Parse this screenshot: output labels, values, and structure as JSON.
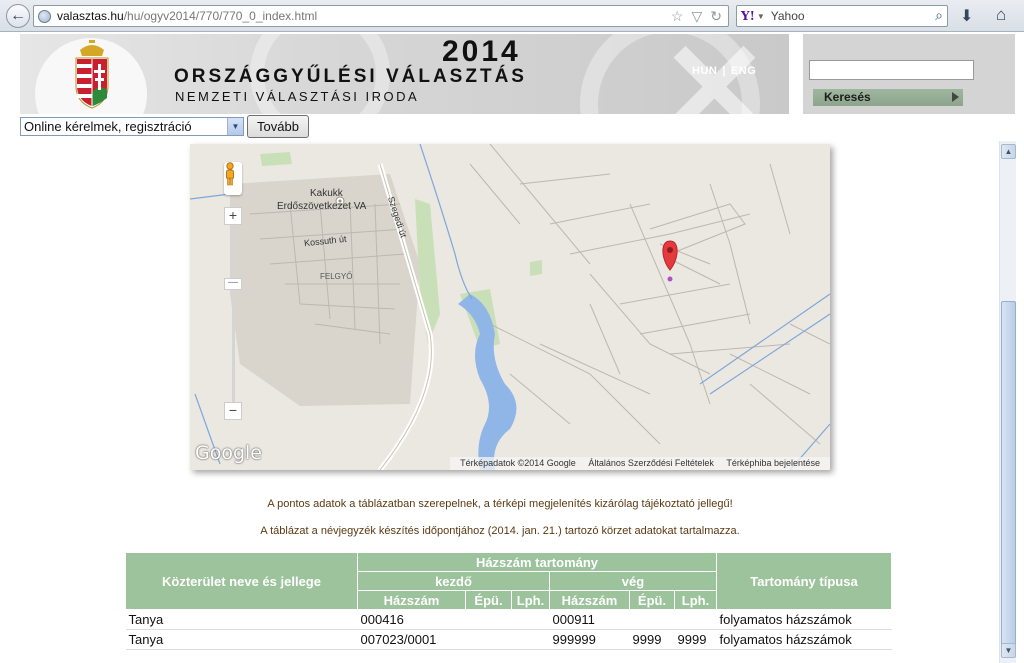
{
  "browser": {
    "url_host": "valasztas.hu",
    "url_path": "/hu/ogyv2014/770/770_0_index.html",
    "search_placeholder": "Yahoo"
  },
  "header": {
    "year": "2014",
    "title": "ORSZÁGGYŰLÉSI VÁLASZTÁS",
    "subtitle": "NEMZETI VÁLASZTÁSI IRODA",
    "lang_hu": "HUN",
    "lang_sep": "|",
    "lang_en": "ENG",
    "search_button": "Keresés"
  },
  "nav": {
    "select_value": "Online kérelmek, regisztráció",
    "go_button": "Tovább"
  },
  "map": {
    "labels": {
      "kakukk": "Kakukk",
      "erdo": "Erdőszövetkezet VA",
      "kossuth": "Kossuth út",
      "szegedi": "Szegedi út",
      "felgyo": "FELGYŐ"
    },
    "logo": "Google",
    "attribution": [
      "Térképadatok ©2014 Google",
      "Általános Szerződési Feltételek",
      "Térképhiba bejelentése"
    ],
    "zoom_in": "+",
    "zoom_out": "−"
  },
  "notes": {
    "line1": "A pontos adatok a táblázatban szerepelnek, a térképi megjelenítés kizárólag tájékoztató jellegű!",
    "line2": "A táblázat a névjegyzék készítés időpontjához (2014. jan. 21.) tartozó körzet adatokat tartalmazza."
  },
  "table": {
    "h_street": "Közterület neve és jellege",
    "h_range": "Házszám tartomány",
    "h_start": "kezdő",
    "h_end": "vég",
    "h_type": "Tartomány típusa",
    "h_hazszam": "Házszám",
    "h_epu": "Épü.",
    "h_lph": "Lph.",
    "rows": [
      [
        "Tanya",
        "000416",
        "",
        "",
        "000911",
        "",
        "",
        "folyamatos házszámok"
      ],
      [
        "Tanya",
        "007023/0001",
        "",
        "",
        "999999",
        "9999",
        "9999",
        "folyamatos házszámok"
      ]
    ]
  },
  "colors": {
    "table_header": "#9cc39c",
    "note_text": "#5a3a12",
    "search_button": "#8ca58c"
  }
}
